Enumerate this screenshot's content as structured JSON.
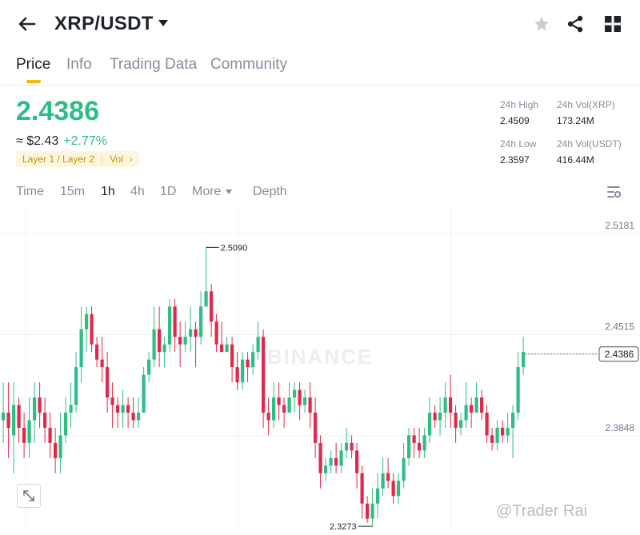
{
  "header": {
    "pair": "XRP/USDT",
    "icons": [
      "back-arrow-icon",
      "dropdown-caret-icon",
      "star-icon",
      "share-icon",
      "grid-menu-icon"
    ]
  },
  "tabs": [
    {
      "label": "Price",
      "active": true
    },
    {
      "label": "Info",
      "active": false
    },
    {
      "label": "Trading Data",
      "active": false
    },
    {
      "label": "Community",
      "active": false
    }
  ],
  "ticker": {
    "last_price": "2.4386",
    "fiat_price": "≈ $2.43",
    "change_pct": "+2.77%",
    "tags": [
      "Layer 1 / Layer 2",
      "Vol"
    ],
    "stats": {
      "high_label": "24h High",
      "high_value": "2.4509",
      "low_label": "24h Low",
      "low_value": "2.3597",
      "vol_xrp_label": "24h Vol(XRP)",
      "vol_xrp_value": "173.24M",
      "vol_usdt_label": "24h Vol(USDT)",
      "vol_usdt_value": "416.44M"
    },
    "colors": {
      "up": "#2ebd85",
      "down": "#e0294a",
      "accent": "#f0b90b"
    }
  },
  "timeframes": [
    {
      "label": "Time",
      "active": false
    },
    {
      "label": "15m",
      "active": false
    },
    {
      "label": "1h",
      "active": true
    },
    {
      "label": "4h",
      "active": false
    },
    {
      "label": "1D",
      "active": false
    },
    {
      "label": "More",
      "active": false
    },
    {
      "label": "Depth",
      "active": false
    }
  ],
  "chart_data": {
    "type": "candlestick",
    "y_ticks": [
      "2.5181",
      "2.4515",
      "2.3848"
    ],
    "ylim": [
      2.3219,
      2.5361
    ],
    "current_price_label": "2.4386",
    "high_annotation": "2.5090",
    "low_annotation": "2.3273",
    "watermark_text": "BINANCE",
    "candles": [
      [
        2.395,
        2.4,
        2.42,
        2.38
      ],
      [
        2.4,
        2.39,
        2.42,
        2.37
      ],
      [
        2.385,
        2.405,
        2.42,
        2.36
      ],
      [
        2.405,
        2.39,
        2.41,
        2.38
      ],
      [
        2.39,
        2.38,
        2.4,
        2.37
      ],
      [
        2.38,
        2.395,
        2.41,
        2.37
      ],
      [
        2.395,
        2.41,
        2.42,
        2.38
      ],
      [
        2.41,
        2.4,
        2.42,
        2.39
      ],
      [
        2.4,
        2.39,
        2.41,
        2.38
      ],
      [
        2.39,
        2.38,
        2.4,
        2.37
      ],
      [
        2.38,
        2.37,
        2.39,
        2.36
      ],
      [
        2.37,
        2.385,
        2.4,
        2.36
      ],
      [
        2.385,
        2.4,
        2.41,
        2.38
      ],
      [
        2.4,
        2.405,
        2.42,
        2.39
      ],
      [
        2.405,
        2.43,
        2.44,
        2.4
      ],
      [
        2.43,
        2.455,
        2.47,
        2.42
      ],
      [
        2.455,
        2.465,
        2.47,
        2.44
      ],
      [
        2.465,
        2.445,
        2.47,
        2.44
      ],
      [
        2.445,
        2.435,
        2.45,
        2.43
      ],
      [
        2.435,
        2.43,
        2.45,
        2.42
      ],
      [
        2.43,
        2.41,
        2.44,
        2.4
      ],
      [
        2.41,
        2.405,
        2.42,
        2.39
      ],
      [
        2.405,
        2.4,
        2.41,
        2.39
      ],
      [
        2.4,
        2.405,
        2.415,
        2.39
      ],
      [
        2.405,
        2.4,
        2.41,
        2.39
      ],
      [
        2.4,
        2.395,
        2.41,
        2.39
      ],
      [
        2.395,
        2.4,
        2.41,
        2.39
      ],
      [
        2.4,
        2.425,
        2.43,
        2.4
      ],
      [
        2.425,
        2.435,
        2.44,
        2.42
      ],
      [
        2.435,
        2.455,
        2.47,
        2.43
      ],
      [
        2.455,
        2.44,
        2.47,
        2.43
      ],
      [
        2.44,
        2.445,
        2.45,
        2.43
      ],
      [
        2.445,
        2.47,
        2.475,
        2.44
      ],
      [
        2.47,
        2.45,
        2.475,
        2.44
      ],
      [
        2.45,
        2.445,
        2.46,
        2.43
      ],
      [
        2.445,
        2.45,
        2.46,
        2.44
      ],
      [
        2.45,
        2.455,
        2.47,
        2.44
      ],
      [
        2.455,
        2.45,
        2.46,
        2.43
      ],
      [
        2.45,
        2.47,
        2.48,
        2.445
      ],
      [
        2.47,
        2.48,
        2.509,
        2.47
      ],
      [
        2.48,
        2.46,
        2.485,
        2.45
      ],
      [
        2.46,
        2.445,
        2.465,
        2.44
      ],
      [
        2.445,
        2.44,
        2.46,
        2.44
      ],
      [
        2.44,
        2.445,
        2.45,
        2.44
      ],
      [
        2.445,
        2.43,
        2.45,
        2.42
      ],
      [
        2.43,
        2.42,
        2.44,
        2.415
      ],
      [
        2.42,
        2.435,
        2.44,
        2.415
      ],
      [
        2.435,
        2.43,
        2.44,
        2.42
      ],
      [
        2.43,
        2.44,
        2.445,
        2.425
      ],
      [
        2.44,
        2.45,
        2.46,
        2.435
      ],
      [
        2.45,
        2.4,
        2.455,
        2.39
      ],
      [
        2.4,
        2.395,
        2.41,
        2.385
      ],
      [
        2.395,
        2.41,
        2.42,
        2.39
      ],
      [
        2.41,
        2.405,
        2.42,
        2.395
      ],
      [
        2.405,
        2.4,
        2.41,
        2.39
      ],
      [
        2.4,
        2.41,
        2.42,
        2.4
      ],
      [
        2.41,
        2.415,
        2.42,
        2.4
      ],
      [
        2.415,
        2.405,
        2.42,
        2.395
      ],
      [
        2.405,
        2.41,
        2.415,
        2.4
      ],
      [
        2.41,
        2.4,
        2.42,
        2.39
      ],
      [
        2.4,
        2.38,
        2.41,
        2.37
      ],
      [
        2.38,
        2.36,
        2.385,
        2.35
      ],
      [
        2.36,
        2.365,
        2.37,
        2.355
      ],
      [
        2.365,
        2.37,
        2.375,
        2.36
      ],
      [
        2.37,
        2.365,
        2.38,
        2.36
      ],
      [
        2.365,
        2.375,
        2.38,
        2.36
      ],
      [
        2.375,
        2.38,
        2.39,
        2.37
      ],
      [
        2.38,
        2.375,
        2.385,
        2.37
      ],
      [
        2.375,
        2.36,
        2.38,
        2.35
      ],
      [
        2.36,
        2.34,
        2.365,
        2.33
      ],
      [
        2.34,
        2.33,
        2.345,
        2.3273
      ],
      [
        2.33,
        2.34,
        2.35,
        2.325
      ],
      [
        2.34,
        2.35,
        2.36,
        2.33
      ],
      [
        2.35,
        2.36,
        2.37,
        2.345
      ],
      [
        2.36,
        2.355,
        2.37,
        2.35
      ],
      [
        2.355,
        2.345,
        2.36,
        2.34
      ],
      [
        2.345,
        2.355,
        2.36,
        2.34
      ],
      [
        2.355,
        2.37,
        2.38,
        2.35
      ],
      [
        2.37,
        2.385,
        2.39,
        2.365
      ],
      [
        2.385,
        2.38,
        2.39,
        2.37
      ],
      [
        2.38,
        2.375,
        2.39,
        2.37
      ],
      [
        2.375,
        2.385,
        2.39,
        2.37
      ],
      [
        2.385,
        2.4,
        2.41,
        2.38
      ],
      [
        2.4,
        2.395,
        2.405,
        2.39
      ],
      [
        2.395,
        2.4,
        2.41,
        2.385
      ],
      [
        2.4,
        2.41,
        2.42,
        2.39
      ],
      [
        2.41,
        2.4,
        2.425,
        2.39
      ],
      [
        2.4,
        2.39,
        2.405,
        2.38
      ],
      [
        2.39,
        2.395,
        2.4,
        2.385
      ],
      [
        2.395,
        2.405,
        2.42,
        2.39
      ],
      [
        2.405,
        2.4,
        2.41,
        2.39
      ],
      [
        2.4,
        2.41,
        2.42,
        2.4
      ],
      [
        2.41,
        2.4,
        2.415,
        2.395
      ],
      [
        2.4,
        2.385,
        2.405,
        2.38
      ],
      [
        2.385,
        2.38,
        2.39,
        2.375
      ],
      [
        2.38,
        2.39,
        2.395,
        2.375
      ],
      [
        2.39,
        2.385,
        2.395,
        2.38
      ],
      [
        2.385,
        2.39,
        2.4,
        2.38
      ],
      [
        2.39,
        2.4,
        2.405,
        2.37
      ],
      [
        2.4,
        2.43,
        2.44,
        2.395
      ],
      [
        2.43,
        2.44,
        2.45,
        2.425
      ]
    ]
  },
  "chart_controls": {
    "icons": [
      "expand-icon",
      "chart-settings-icon"
    ]
  },
  "footer_watermark": "@Trader Rai"
}
